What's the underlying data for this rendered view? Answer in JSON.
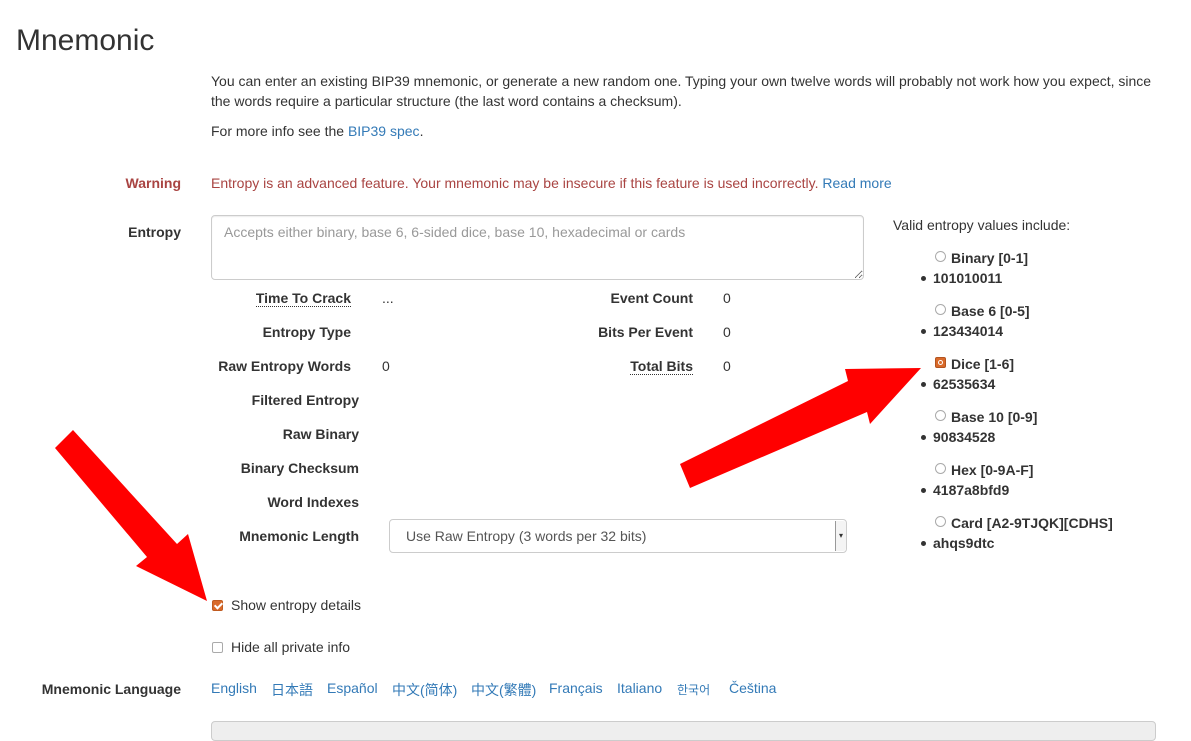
{
  "section": {
    "title": "Mnemonic"
  },
  "intro": {
    "paragraph1": "You can enter an existing BIP39 mnemonic, or generate a new random one. Typing your own twelve words will probably not work how you expect, since the words require a particular structure (the last word contains a checksum).",
    "paragraph2_prefix": "For more info see the ",
    "paragraph2_link": "BIP39 spec",
    "paragraph2_suffix": "."
  },
  "warning": {
    "label": "Warning",
    "text": "Entropy is an advanced feature. Your mnemonic may be insecure if this feature is used incorrectly.",
    "link": "Read more"
  },
  "entropy": {
    "label": "Entropy",
    "placeholder": "Accepts either binary, base 6, 6-sided dice, base 10, hexadecimal or cards",
    "value": ""
  },
  "details": {
    "time_to_crack": {
      "label": "Time To Crack",
      "value": "..."
    },
    "entropy_type": {
      "label": "Entropy Type",
      "value": ""
    },
    "raw_entropy_words": {
      "label": "Raw Entropy Words",
      "value": "0"
    },
    "event_count": {
      "label": "Event Count",
      "value": "0"
    },
    "bits_per_event": {
      "label": "Bits Per Event",
      "value": "0"
    },
    "total_bits": {
      "label": "Total Bits",
      "value": "0"
    },
    "filtered_entropy": {
      "label": "Filtered Entropy"
    },
    "raw_binary": {
      "label": "Raw Binary"
    },
    "binary_checksum": {
      "label": "Binary Checksum"
    },
    "word_indexes": {
      "label": "Word Indexes"
    },
    "mnemonic_length": {
      "label": "Mnemonic Length",
      "selected": "Use Raw Entropy (3 words per 32 bits)"
    }
  },
  "valid_entropy": {
    "heading": "Valid entropy values include:",
    "options": [
      {
        "name": "Binary [0-1]",
        "example": "101010011",
        "checked": false
      },
      {
        "name": "Base 6 [0-5]",
        "example": "123434014",
        "checked": false
      },
      {
        "name": "Dice [1-6]",
        "example": "62535634",
        "checked": true
      },
      {
        "name": "Base 10 [0-9]",
        "example": "90834528",
        "checked": false
      },
      {
        "name": "Hex [0-9A-F]",
        "example": "4187a8bfd9",
        "checked": false
      },
      {
        "name": "Card [A2-9TJQK][CDHS]",
        "example": "ahqs9dtc",
        "checked": false
      }
    ]
  },
  "checkboxes": {
    "show_entropy_details": {
      "label": "Show entropy details",
      "checked": true
    },
    "hide_private_info": {
      "label": "Hide all private info",
      "checked": false
    }
  },
  "language": {
    "label": "Mnemonic Language",
    "options": [
      "English",
      "日本語",
      "Español",
      "中文(简体)",
      "中文(繁體)",
      "Français",
      "Italiano",
      "한국어",
      "Čeština"
    ]
  },
  "colors": {
    "link": "#337ab7",
    "warning": "#a94442",
    "annotation_arrow": "#ff0000",
    "checkbox_accent": "#d96a2a"
  }
}
